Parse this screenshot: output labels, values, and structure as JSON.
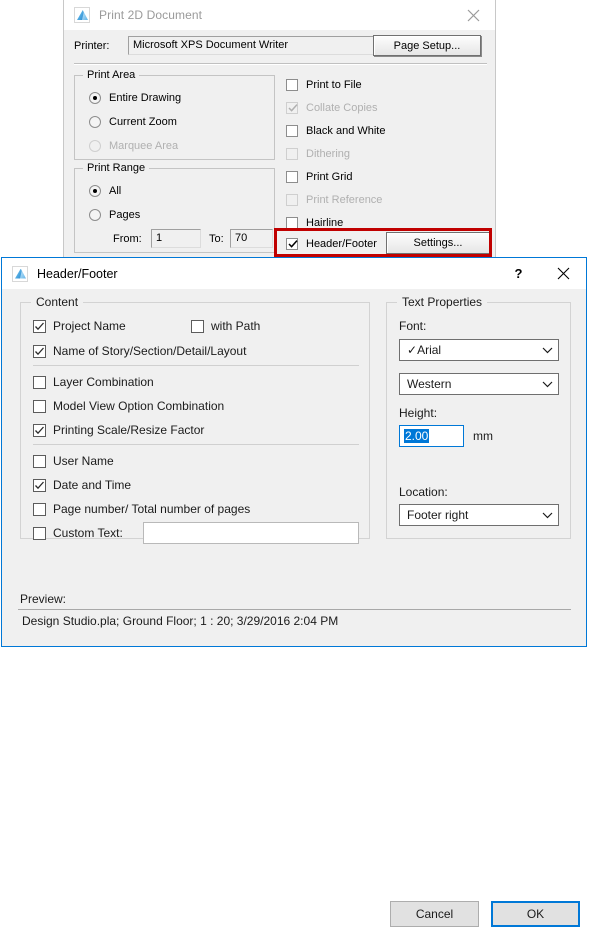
{
  "print_dialog": {
    "title": "Print 2D Document",
    "icon": "app-mountain-icon",
    "close_icon": "close-icon",
    "printer_label": "Printer:",
    "printer_value": "Microsoft XPS Document Writer",
    "page_setup_label": "Page Setup...",
    "print_area": {
      "title": "Print Area",
      "options": [
        {
          "label": "Entire Drawing",
          "checked": true,
          "disabled": false
        },
        {
          "label": "Current Zoom",
          "checked": false,
          "disabled": false
        },
        {
          "label": "Marquee Area",
          "checked": false,
          "disabled": true
        }
      ]
    },
    "print_range": {
      "title": "Print Range",
      "options": [
        {
          "label": "All",
          "checked": true,
          "disabled": false
        },
        {
          "label": "Pages",
          "checked": false,
          "disabled": false
        }
      ],
      "from_label": "From:",
      "from_value": "1",
      "to_label": "To:",
      "to_value": "70"
    },
    "options": [
      {
        "label": "Print to File",
        "checked": false,
        "disabled": false
      },
      {
        "label": "Collate Copies",
        "checked": true,
        "disabled": true
      },
      {
        "label": "Black and White",
        "checked": false,
        "disabled": false
      },
      {
        "label": "Dithering",
        "checked": false,
        "disabled": true
      },
      {
        "label": "Print Grid",
        "checked": false,
        "disabled": false
      },
      {
        "label": "Print Reference",
        "checked": false,
        "disabled": true
      },
      {
        "label": "Hairline",
        "checked": false,
        "disabled": false
      },
      {
        "label": "Header/Footer",
        "checked": true,
        "disabled": false
      }
    ],
    "settings_label": "Settings...",
    "highlight_color": "#c00000"
  },
  "header_footer_dialog": {
    "title": "Header/Footer",
    "icon": "app-mountain-icon",
    "help_label": "?",
    "close_icon": "close-icon",
    "content": {
      "title": "Content",
      "items": [
        {
          "label": "Project Name",
          "checked": true
        },
        {
          "label": "with Path",
          "checked": false
        },
        {
          "label": "Name of Story/Section/Detail/Layout",
          "checked": true
        },
        {
          "label": "Layer Combination",
          "checked": false
        },
        {
          "label": "Model View Option Combination",
          "checked": false
        },
        {
          "label": "Printing Scale/Resize Factor",
          "checked": true
        },
        {
          "label": "User Name",
          "checked": false
        },
        {
          "label": "Date and Time",
          "checked": true
        },
        {
          "label": "Page number/ Total number of pages",
          "checked": false
        },
        {
          "label": "Custom Text:",
          "checked": false
        }
      ],
      "custom_text_value": ""
    },
    "text_properties": {
      "title": "Text Properties",
      "font_label": "Font:",
      "font_value": "Arial",
      "font_check_glyph": "✓",
      "script_value": "Western",
      "height_label": "Height:",
      "height_value": "2.00",
      "height_unit": "mm",
      "location_label": "Location:",
      "location_value": "Footer right"
    },
    "preview_label": "Preview:",
    "preview_value": "Design Studio.pla; Ground Floor; 1 : 20; 3/29/2016 2:04 PM",
    "buttons": {
      "cancel": "Cancel",
      "ok": "OK"
    },
    "accent_color": "#0078d7"
  }
}
